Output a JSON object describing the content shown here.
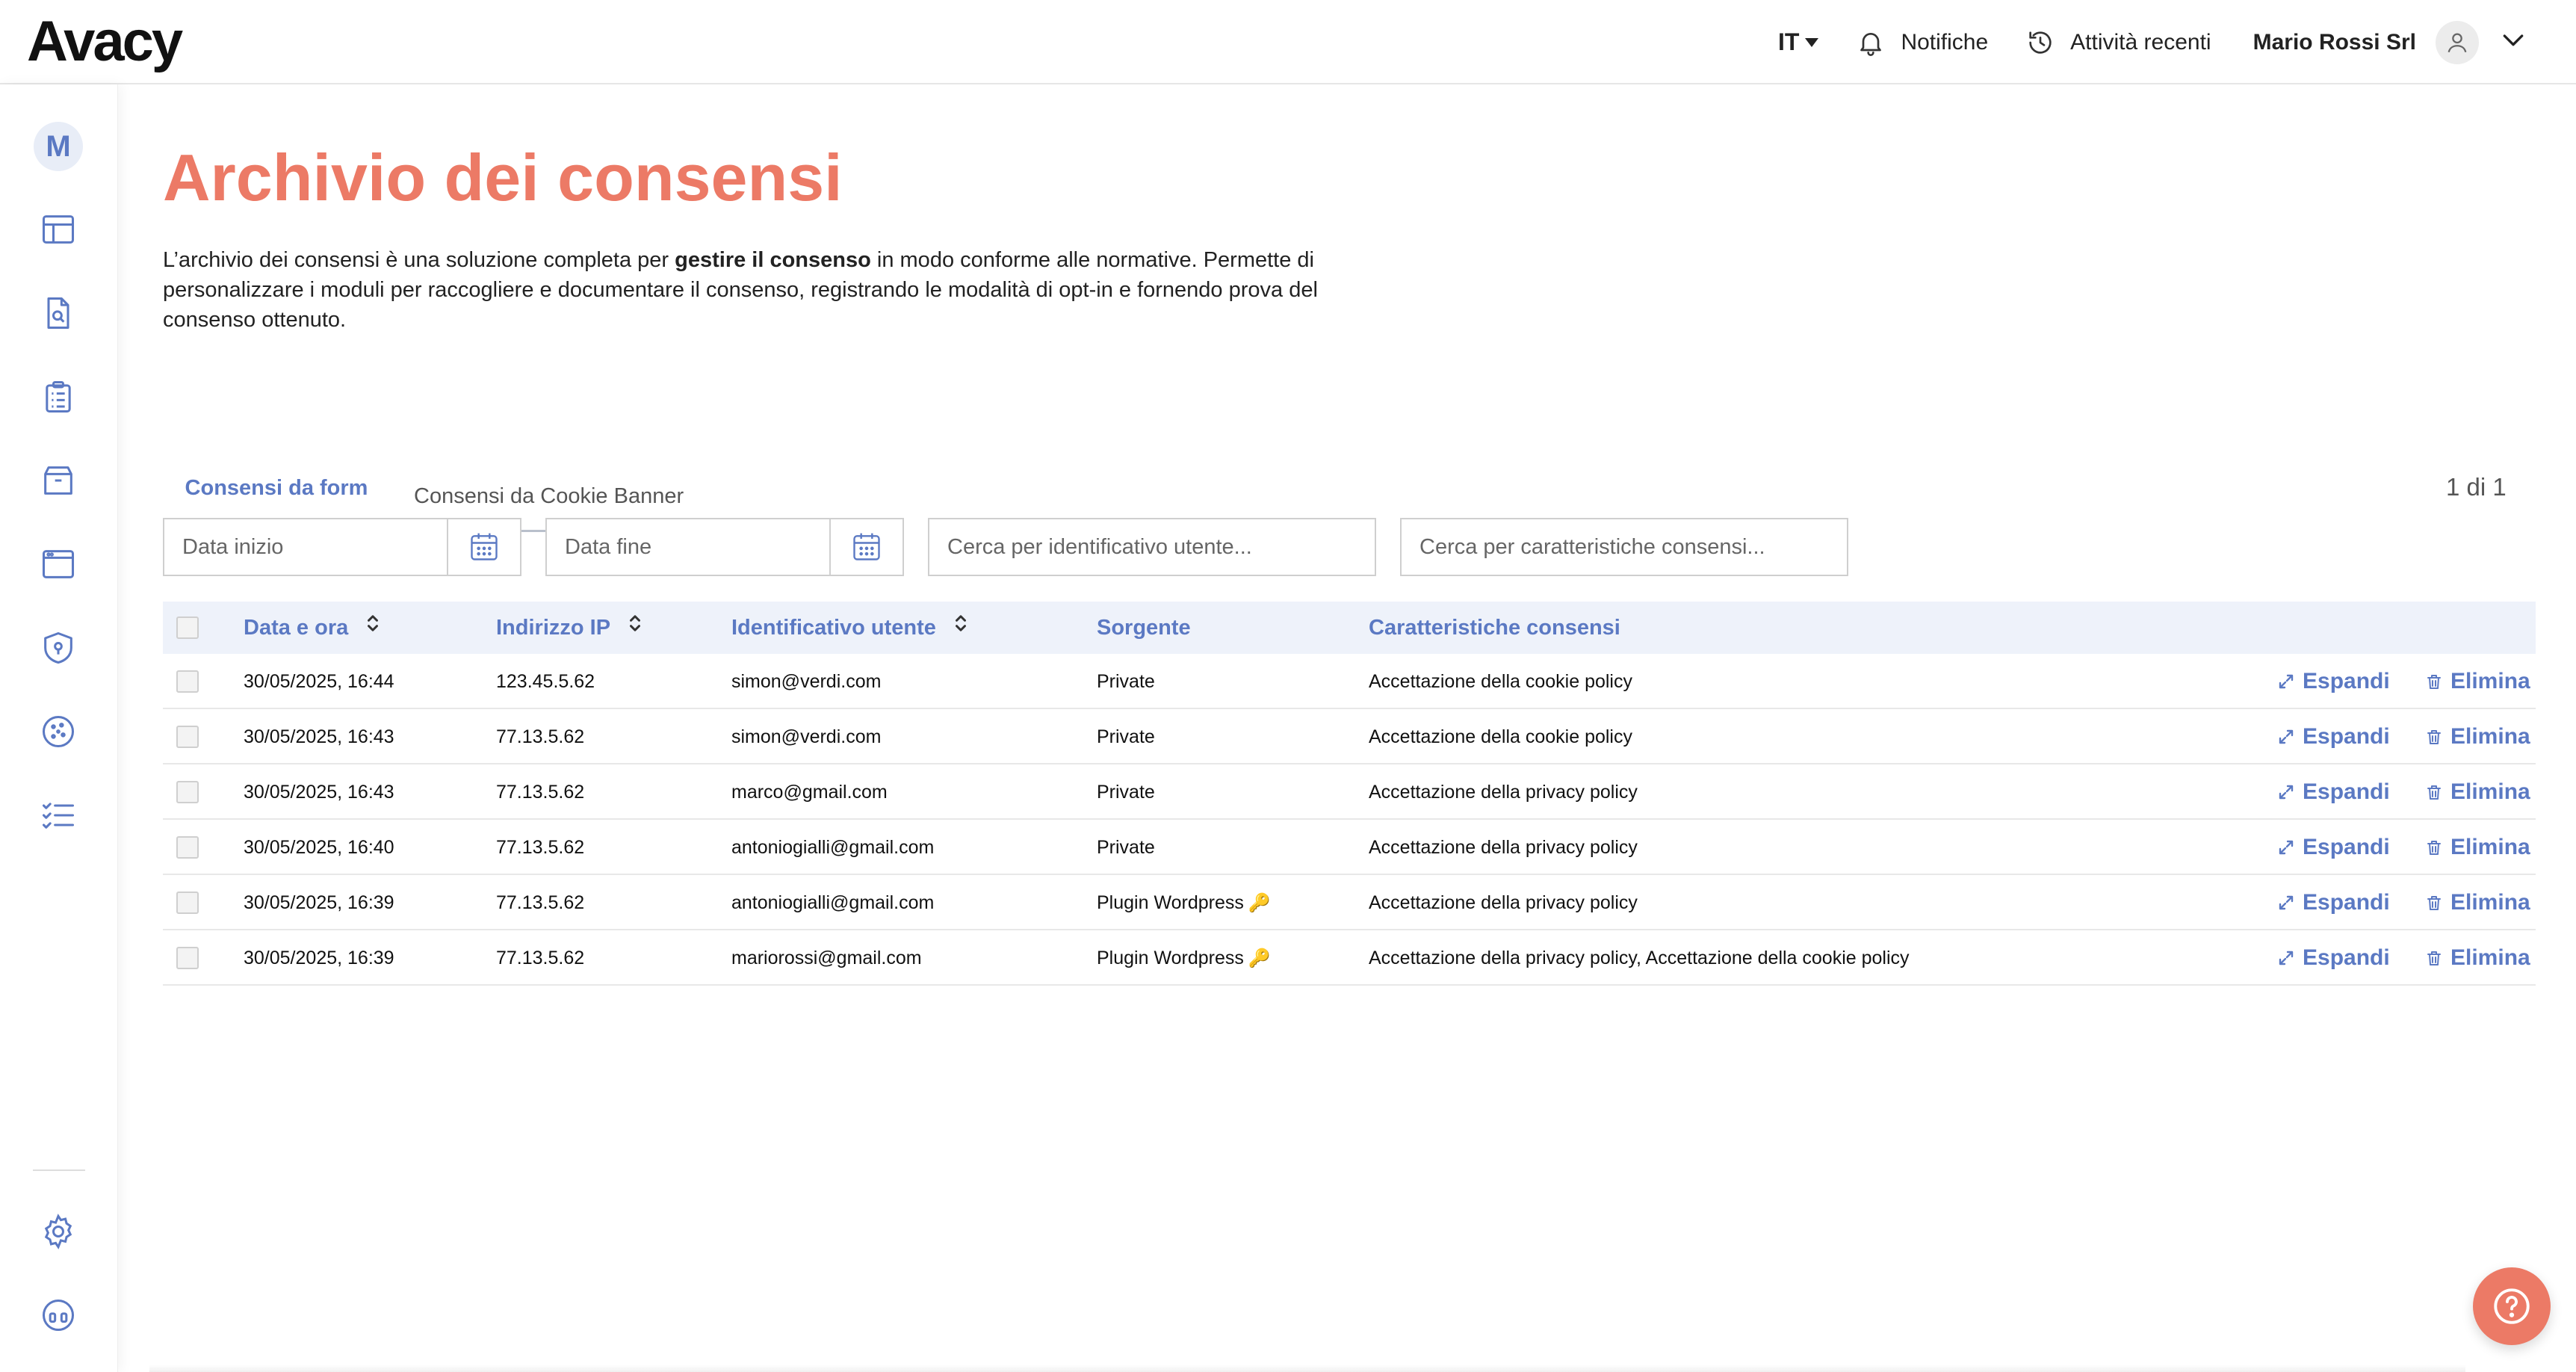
{
  "header": {
    "logo": "Avacy",
    "language": "IT",
    "notifications_label": "Notifiche",
    "recent_label": "Attività recenti",
    "company": "Mario Rossi Srl"
  },
  "sidebar": {
    "avatar_letter": "M",
    "icons": [
      "layout-icon",
      "document-search-icon",
      "clipboard-list-icon",
      "box-icon",
      "browser-window-icon",
      "shield-icon",
      "cookie-icon",
      "checklist-icon",
      "settings-icon",
      "headset-icon"
    ]
  },
  "page": {
    "title": "Archivio dei consensi",
    "description_part1": "L’archivio dei consensi è una soluzione completa per ",
    "description_bold": "gestire il consenso",
    "description_part2": " in modo conforme alle normative. Permette di personalizzare i moduli per raccogliere e documentare il consenso, registrando le modalità di opt-in e fornendo prova del consenso ottenuto."
  },
  "tabs": [
    {
      "label": "Consensi da form",
      "active": true
    },
    {
      "label": "Consensi da Cookie Banner",
      "active": false
    }
  ],
  "pagination": "1 di 1",
  "filters": {
    "start_date_placeholder": "Data inizio",
    "end_date_placeholder": "Data fine",
    "user_search_placeholder": "Cerca per identificativo utente...",
    "consent_search_placeholder": "Cerca per caratteristiche consensi..."
  },
  "table": {
    "columns": [
      "Data e ora",
      "Indirizzo IP",
      "Identificativo utente",
      "Sorgente",
      "Caratteristiche consensi"
    ],
    "action_expand": "Espandi",
    "action_delete": "Elimina",
    "rows": [
      {
        "date": "30/05/2025, 16:44",
        "ip": "123.45.5.62",
        "user": "simon@verdi.com",
        "source": "Private",
        "key": false,
        "features": "Accettazione della cookie policy"
      },
      {
        "date": "30/05/2025, 16:43",
        "ip": "77.13.5.62",
        "user": "simon@verdi.com",
        "source": "Private",
        "key": false,
        "features": "Accettazione della cookie policy"
      },
      {
        "date": "30/05/2025, 16:43",
        "ip": "77.13.5.62",
        "user": "marco@gmail.com",
        "source": "Private",
        "key": false,
        "features": "Accettazione della privacy policy"
      },
      {
        "date": "30/05/2025, 16:40",
        "ip": "77.13.5.62",
        "user": "antoniogialli@gmail.com",
        "source": "Private",
        "key": false,
        "features": "Accettazione della privacy policy"
      },
      {
        "date": "30/05/2025, 16:39",
        "ip": "77.13.5.62",
        "user": "antoniogialli@gmail.com",
        "source": "Plugin Wordpress",
        "key": true,
        "features": "Accettazione della privacy policy"
      },
      {
        "date": "30/05/2025, 16:39",
        "ip": "77.13.5.62",
        "user": "mariorossi@gmail.com",
        "source": "Plugin Wordpress",
        "key": true,
        "features": "Accettazione della privacy policy, Accettazione della cookie policy"
      }
    ]
  },
  "colors": {
    "accent": "#5b79c3",
    "title": "#ec7a66",
    "help_button": "#ec7a66"
  }
}
